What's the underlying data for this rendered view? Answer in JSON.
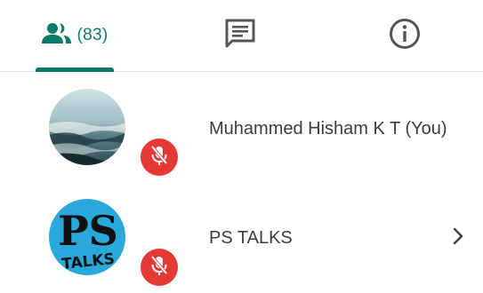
{
  "tabs": {
    "people": {
      "icon": "people-icon",
      "count_label": "(83)"
    },
    "chat": {
      "icon": "chat-icon"
    },
    "info": {
      "icon": "info-icon"
    },
    "active": "people"
  },
  "participants": [
    {
      "name": "Muhammed Hisham K T (You)",
      "avatar": "ocean-photo-avatar",
      "muted": true,
      "expandable": false
    },
    {
      "name": "PS TALKS",
      "avatar": "ps-talks-logo-avatar",
      "avatar_text": [
        "PS",
        "TALKS"
      ],
      "muted": true,
      "expandable": true
    }
  ],
  "colors": {
    "accent": "#0b7a6c",
    "mute_badge": "#e53935",
    "icon_gray": "#555555",
    "text": "#3c3c3c"
  }
}
